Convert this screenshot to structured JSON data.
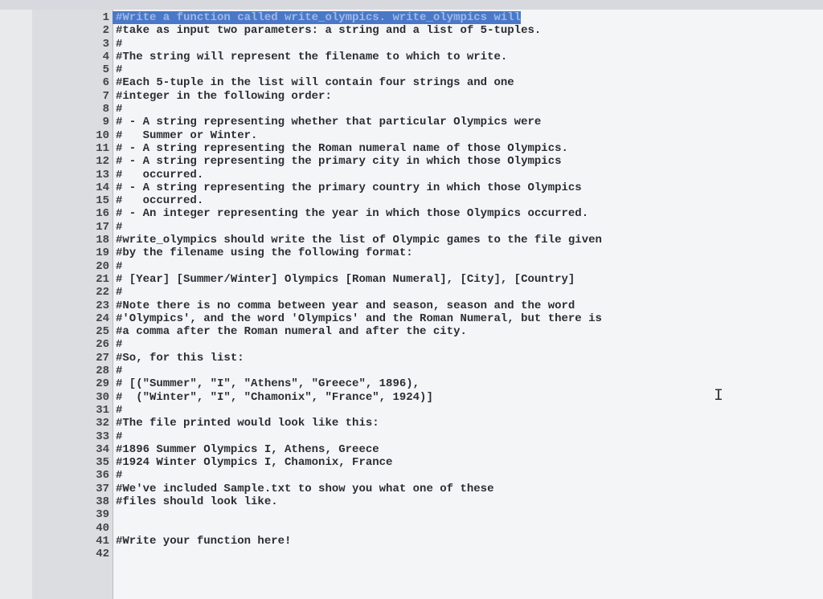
{
  "editor": {
    "selected_line": 1,
    "lines": [
      "#Write a function called write_olympics. write_olympics will",
      "#take as input two parameters: a string and a list of 5-tuples.",
      "#",
      "#The string will represent the filename to which to write.",
      "#",
      "#Each 5-tuple in the list will contain four strings and one",
      "#integer in the following order:",
      "#",
      "# - A string representing whether that particular Olympics were",
      "#   Summer or Winter.",
      "# - A string representing the Roman numeral name of those Olympics.",
      "# - A string representing the primary city in which those Olympics",
      "#   occurred.",
      "# - A string representing the primary country in which those Olympics",
      "#   occurred.",
      "# - An integer representing the year in which those Olympics occurred.",
      "#",
      "#write_olympics should write the list of Olympic games to the file given",
      "#by the filename using the following format:",
      "#",
      "# [Year] [Summer/Winter] Olympics [Roman Numeral], [City], [Country]",
      "#",
      "#Note there is no comma between year and season, season and the word",
      "#'Olympics', and the word 'Olympics' and the Roman Numeral, but there is",
      "#a comma after the Roman numeral and after the city.",
      "#",
      "#So, for this list:",
      "#",
      "# [(\"Summer\", \"I\", \"Athens\", \"Greece\", 1896),",
      "#  (\"Winter\", \"I\", \"Chamonix\", \"France\", 1924)]",
      "#",
      "#The file printed would look like this:",
      "#",
      "#1896 Summer Olympics I, Athens, Greece",
      "#1924 Winter Olympics I, Chamonix, France",
      "#",
      "#We've included Sample.txt to show you what one of these",
      "#files should look like.",
      "",
      "",
      "#Write your function here!",
      ""
    ]
  }
}
